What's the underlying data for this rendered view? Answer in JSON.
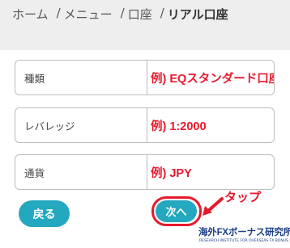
{
  "breadcrumb": {
    "items": [
      "ホーム",
      "メニュー",
      "口座"
    ],
    "separator": "/",
    "current": "リアル口座"
  },
  "form": {
    "rows": [
      {
        "label": "種類",
        "value": "例) EQスタンダード口座"
      },
      {
        "label": "レバレッジ",
        "value": "例) 1:2000"
      },
      {
        "label": "通貨",
        "value": "例) JPY"
      }
    ]
  },
  "buttons": {
    "back_label": "戻る",
    "next_label": "次へ"
  },
  "annotation": {
    "tap_label": "タップ",
    "highlight_color": "#e8192c",
    "arrow_icon": "arrow-down-left-icon"
  },
  "logo": {
    "main_text": "海外FXボーナス研究所",
    "sub_text": "RESEARCH INSTITUTE FOR OVERSEAS FX BONUS"
  },
  "colors": {
    "accent": "#23a8bf",
    "value_text": "#e8192c",
    "breadcrumb_bg": "#eeeeee"
  }
}
